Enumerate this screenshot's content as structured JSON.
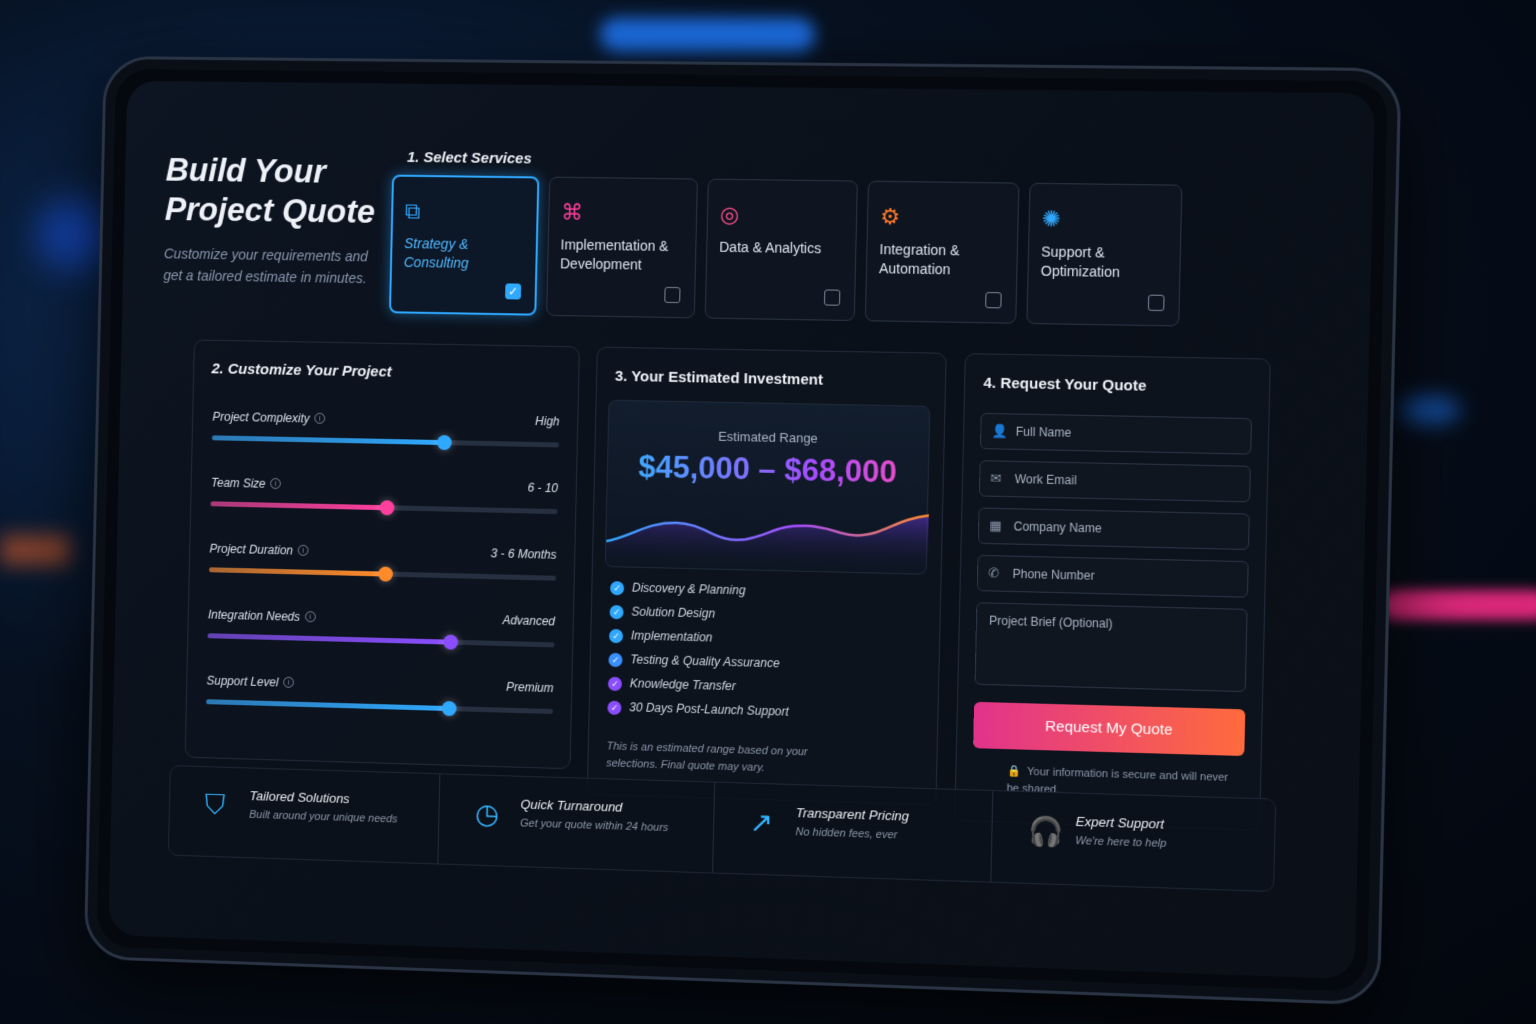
{
  "colors": {
    "accent": "#2fa8ff",
    "pink": "#ff3f9e",
    "orange": "#ff7a2a",
    "purple": "#8a4dff"
  },
  "hero": {
    "title_line1": "Build Your",
    "title_line2": "Project Quote",
    "subtitle": "Customize your requirements and get a tailored estimate in minutes."
  },
  "services": {
    "title": "1. Select Services",
    "items": [
      {
        "label": "Strategy & Consulting",
        "icon": "strategy-icon",
        "checked": true,
        "color": "#2fa8ff"
      },
      {
        "label": "Implementation & Development",
        "icon": "code-icon",
        "checked": false,
        "color": "#ff3f9e"
      },
      {
        "label": "Data & Analytics",
        "icon": "analytics-icon",
        "checked": false,
        "color": "#ff4d8a"
      },
      {
        "label": "Integration & Automation",
        "icon": "integration-icon",
        "checked": false,
        "color": "#ff7a2a"
      },
      {
        "label": "Support & Optimization",
        "icon": "support-gear-icon",
        "checked": false,
        "color": "#2fa8ff"
      }
    ]
  },
  "customize": {
    "title": "2. Customize Your Project",
    "sliders": [
      {
        "label": "Project Complexity",
        "value": "High",
        "level": 0.67,
        "color": "#2fa8ff"
      },
      {
        "label": "Team Size",
        "value": "6 - 10",
        "level": 0.51,
        "color": "#ff3f9e"
      },
      {
        "label": "Project Duration",
        "value": "3 - 6 Months",
        "level": 0.51,
        "color": "#ff8a2a"
      },
      {
        "label": "Integration Needs",
        "value": "Advanced",
        "level": 0.7,
        "color": "#8a4dff"
      },
      {
        "label": "Support Level",
        "value": "Premium",
        "level": 0.7,
        "color": "#2fa8ff"
      }
    ]
  },
  "estimate": {
    "title": "3. Your Estimated Investment",
    "caption": "Estimated Range",
    "range": "$45,000 – $68,000",
    "included": [
      "Discovery & Planning",
      "Solution Design",
      "Implementation",
      "Testing & Quality Assurance",
      "Knowledge Transfer",
      "30 Days Post-Launch Support"
    ],
    "disclaimer": "This is an estimated range based on your selections. Final quote may vary."
  },
  "request": {
    "title": "4. Request Your Quote",
    "fields": [
      {
        "placeholder": "Full Name",
        "icon": "user-icon"
      },
      {
        "placeholder": "Work Email",
        "icon": "mail-icon"
      },
      {
        "placeholder": "Company Name",
        "icon": "building-icon"
      },
      {
        "placeholder": "Phone Number",
        "icon": "phone-icon"
      }
    ],
    "brief_placeholder": "Project Brief (Optional)",
    "button_label": "Request My Quote",
    "secure_note": "Your information is secure and will never be shared."
  },
  "features": [
    {
      "title": "Tailored Solutions",
      "subtitle": "Built around your unique needs",
      "icon": "shield-check-icon"
    },
    {
      "title": "Quick Turnaround",
      "subtitle": "Get your quote within 24 hours",
      "icon": "clock-icon"
    },
    {
      "title": "Transparent Pricing",
      "subtitle": "No hidden fees, ever",
      "icon": "chart-growth-icon"
    },
    {
      "title": "Expert Support",
      "subtitle": "We're here to help",
      "icon": "headset-icon"
    }
  ]
}
